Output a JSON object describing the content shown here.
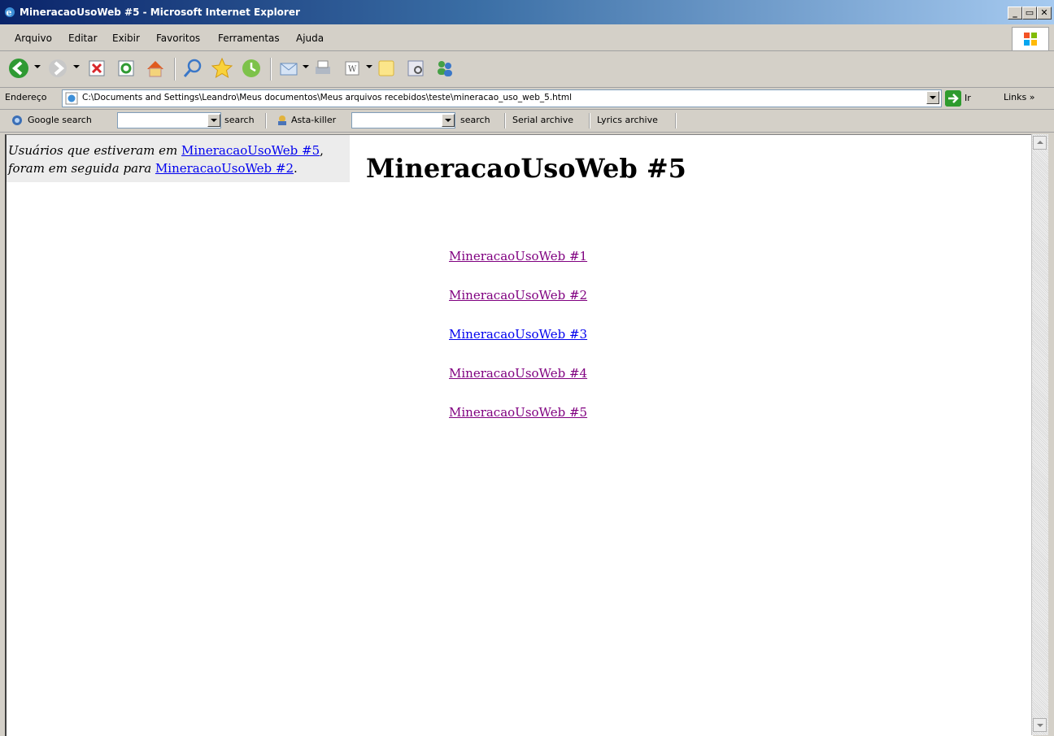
{
  "window": {
    "title": "MineracaoUsoWeb #5 - Microsoft Internet Explorer",
    "minimize_glyph": "_",
    "maximize_glyph": "&#8203;",
    "close_glyph": "✕"
  },
  "menu": {
    "items": [
      "Arquivo",
      "Editar",
      "Exibir",
      "Favoritos",
      "Ferramentas",
      "Ajuda"
    ]
  },
  "toolbar": {
    "icons": [
      "back-icon",
      "forward-icon",
      "stop-icon",
      "refresh-icon",
      "home-icon",
      "search-icon",
      "favorites-icon",
      "history-icon",
      "mail-icon",
      "print-icon",
      "edit-icon",
      "discuss-icon",
      "research-icon",
      "messenger-icon"
    ]
  },
  "address": {
    "label": "Endereço",
    "url": "C:\\Documents and Settings\\Leandro\\Meus documentos\\Meus arquivos recebidos\\teste\\mineracao_uso_web_5.html",
    "go_label": "Ir",
    "links_label": "Links »"
  },
  "google_bar": {
    "google_label": "Google search",
    "search1_label": "search",
    "asta_label": "Asta-killer",
    "search2_label": "search",
    "serial_label": "Serial archive",
    "lyrics_label": "Lyrics archive"
  },
  "page": {
    "note_prefix1": "Usuários que estiveram em ",
    "note_link1": "MineracaoUsoWeb #5",
    "note_suffix1": ",",
    "note_prefix2": "foram em seguida para ",
    "note_link2": "MineracaoUsoWeb #2",
    "note_suffix2": ".",
    "heading": "MineracaoUsoWeb #5",
    "links": [
      {
        "label": "MineracaoUsoWeb #1",
        "visited": true
      },
      {
        "label": "MineracaoUsoWeb #2",
        "visited": true
      },
      {
        "label": "MineracaoUsoWeb #3",
        "visited": false
      },
      {
        "label": "MineracaoUsoWeb #4",
        "visited": true
      },
      {
        "label": "MineracaoUsoWeb #5",
        "visited": true
      }
    ]
  },
  "colors": {
    "link": "#0000ee",
    "visited_link": "#800080"
  }
}
